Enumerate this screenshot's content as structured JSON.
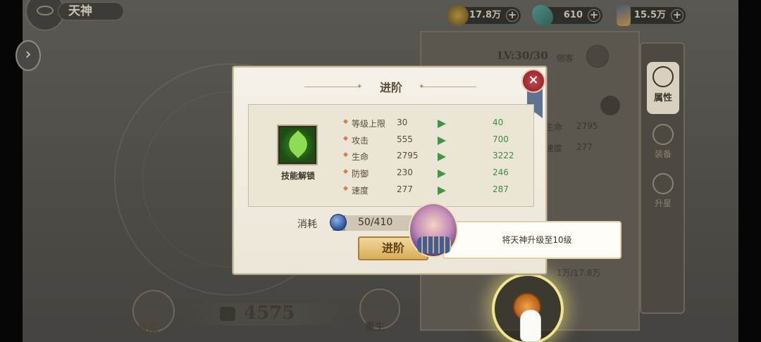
{
  "header": {
    "title": "天神"
  },
  "currencies": [
    {
      "icon": "gold-coin-icon",
      "value": "17.8万"
    },
    {
      "icon": "jade-crystal-icon",
      "value": "610"
    },
    {
      "icon": "scroll-item-icon",
      "value": "15.5万"
    }
  ],
  "hero_panel": {
    "level": "LV:30/30",
    "class_label": "侧客",
    "stats": [
      {
        "label": "生命",
        "value": "2795"
      },
      {
        "label": "速度",
        "value": "277"
      }
    ],
    "cost_progress": "1万/17.8万"
  },
  "tabs": [
    {
      "label": "属性",
      "active": true
    },
    {
      "label": "装备",
      "active": false
    },
    {
      "label": "升星",
      "active": false
    }
  ],
  "bottom": {
    "foster_label": "育成",
    "power": "4575",
    "rebirth_label": "重生"
  },
  "modal": {
    "title": "进阶",
    "close_label": "×",
    "skill_label": "技能解锁",
    "stats": [
      {
        "name": "等级上限",
        "old": "30",
        "new": "40"
      },
      {
        "name": "攻击",
        "old": "555",
        "new": "700"
      },
      {
        "name": "生命",
        "old": "2795",
        "new": "3222"
      },
      {
        "name": "防御",
        "old": "230",
        "new": "246"
      },
      {
        "name": "速度",
        "old": "277",
        "new": "287"
      }
    ],
    "cost_label": "消耗",
    "cost_have": "50",
    "cost_need": "/410",
    "cost_fraction": 0.122,
    "advance_button": "进阶"
  },
  "guide": {
    "text": "将天神升级至10级"
  },
  "colors": {
    "accent_gold": "#d7ad59",
    "stat_up_green": "#3c8e3c",
    "close_red": "#c9464b"
  }
}
